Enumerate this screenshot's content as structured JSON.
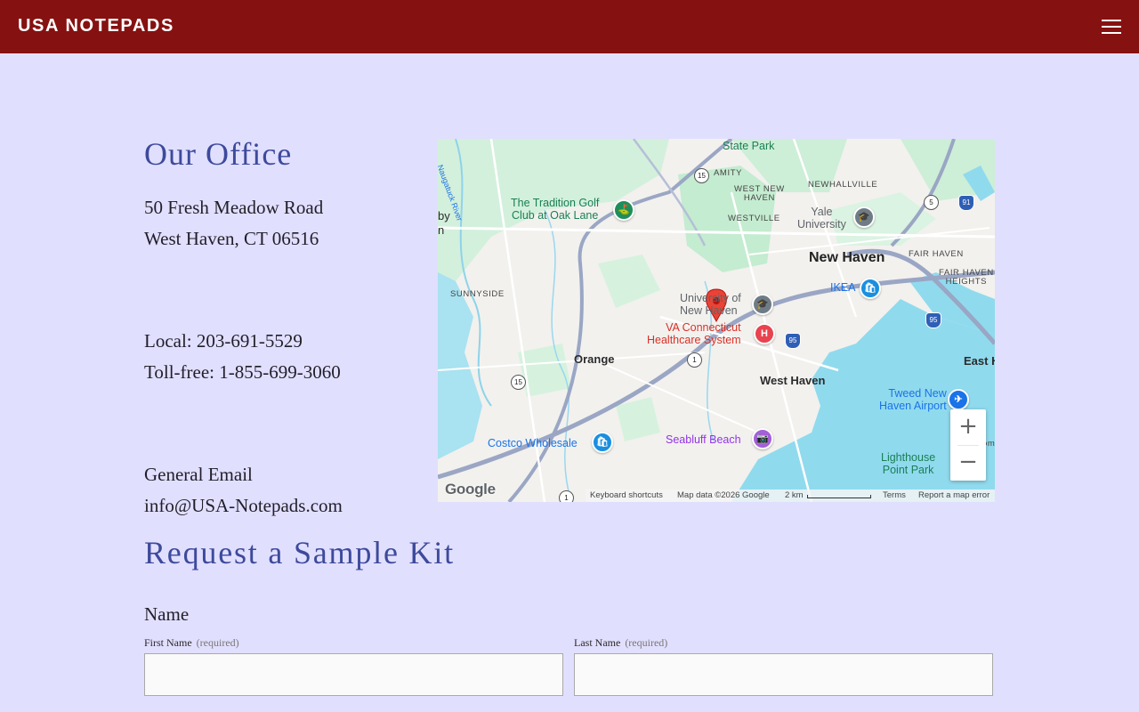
{
  "header": {
    "brand": "USA NOTEPADS",
    "menu_icon": "hamburger-menu-icon"
  },
  "office": {
    "heading": "Our Office",
    "address_line1": "50 Fresh Meadow Road",
    "address_line2": "West Haven, CT 06516",
    "phone_local": "Local: 203-691-5529",
    "phone_tollfree": "Toll-free: 1-855-699-3060",
    "email_label": "General Email",
    "email": "info@USA-Notepads.com"
  },
  "map": {
    "labels": {
      "state_park": "State Park",
      "amity": "AMITY",
      "west_new_haven": "WEST NEW\nHAVEN",
      "newhallville": "NEWHALLVILLE",
      "westville": "WESTVILLE",
      "tradition_golf": "The Tradition Golf\nClub at Oak Lane",
      "yale": "Yale\nUniversity",
      "new_haven": "New Haven",
      "fair_haven": "FAIR HAVEN",
      "fair_haven_heights": "FAIR HAVEN\nHEIGHTS",
      "ikea": "IKEA",
      "sunnyside": "SUNNYSIDE",
      "univ_new_haven": "University of\nNew Haven",
      "va_connecticut": "VA Connecticut\nHealthcare System",
      "orange": "Orange",
      "west_haven": "West Haven",
      "east_h": "East H",
      "tweed": "Tweed New\nHaven Airport",
      "costco": "Costco Wholesale",
      "seabluff": "Seabluff Beach",
      "lighthouse": "Lighthouse\nPoint Park",
      "by": "by",
      "n": "n",
      "om": "om",
      "naugatuck": "Naugatuck River"
    },
    "shields": {
      "r15a": "15",
      "r15b": "15",
      "r5": "5",
      "r1": "1",
      "r1b": "1",
      "i91": "91",
      "i95a": "95",
      "i95b": "95"
    },
    "zoom_in": "+",
    "zoom_out": "−",
    "google_logo": "Google",
    "footer": {
      "keyboard": "Keyboard shortcuts",
      "map_data": "Map data ©2026 Google",
      "scale": "2 km",
      "terms": "Terms",
      "report": "Report a map error"
    }
  },
  "sample_kit": {
    "heading": "Request a Sample Kit",
    "name_label": "Name",
    "first_name_label": "First Name",
    "last_name_label": "Last Name",
    "required_note": "(required)",
    "first_name_value": "",
    "last_name_value": ""
  },
  "colors": {
    "header_bg": "#861111",
    "page_bg": "#e1dffe",
    "heading": "#3d4a9c",
    "water": "#90daee",
    "park": "#c4ecd0",
    "pin": "#ea4335"
  }
}
